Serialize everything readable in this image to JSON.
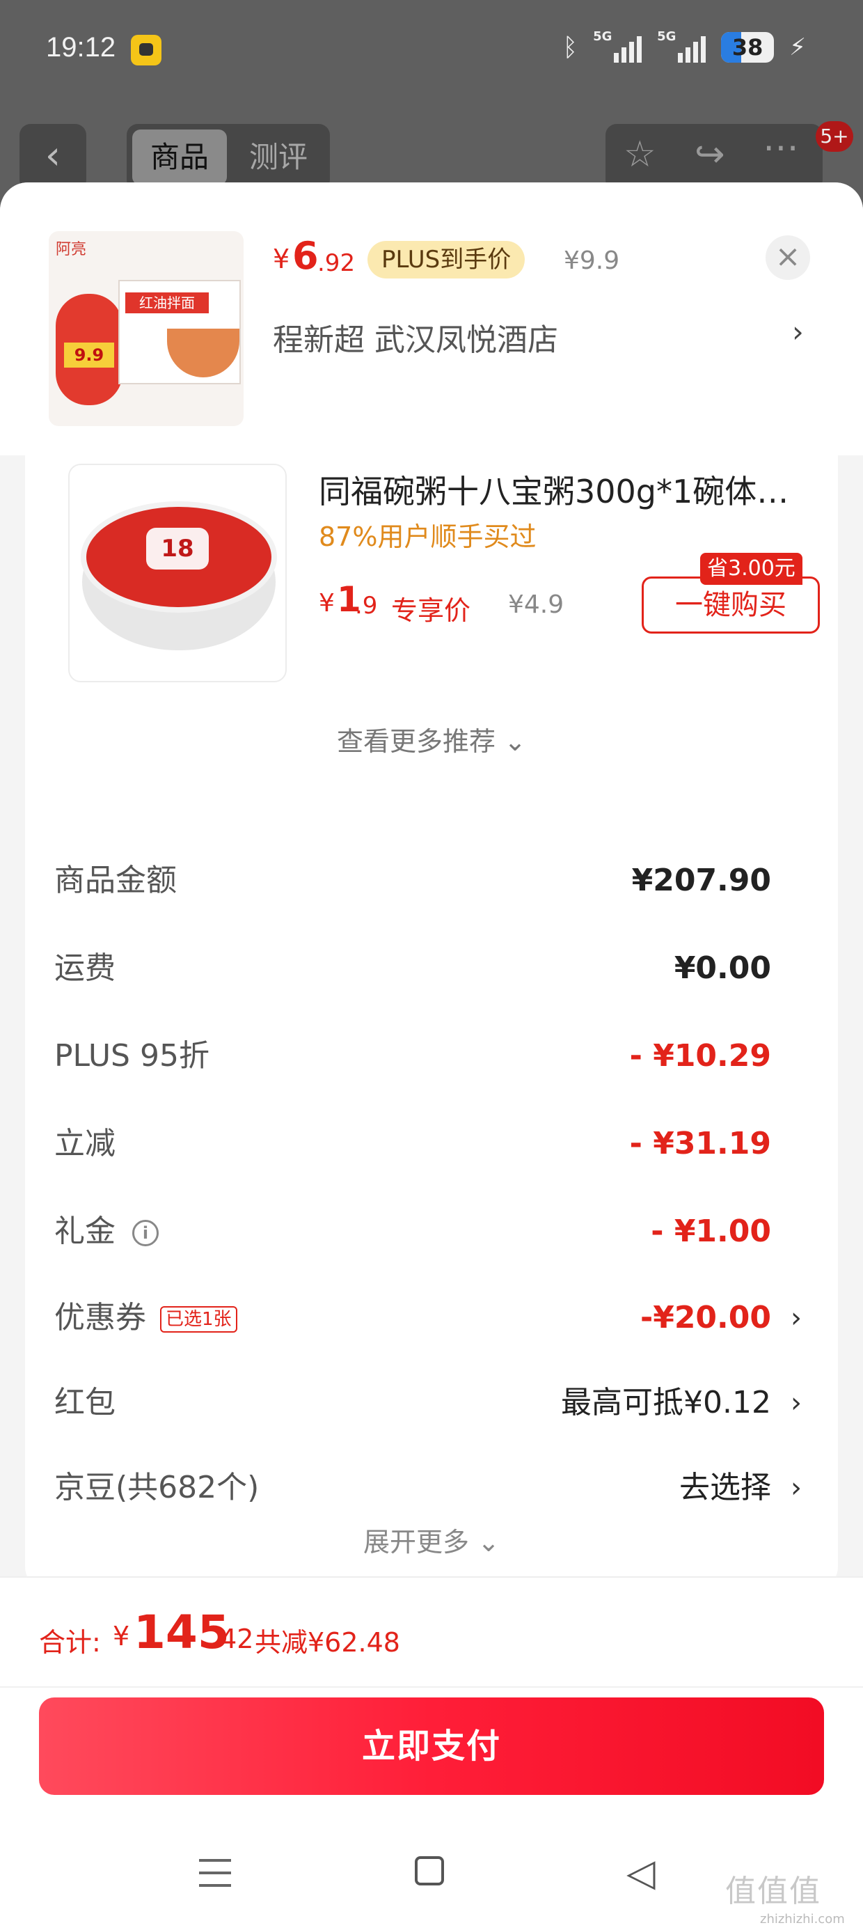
{
  "status_bar": {
    "time": "19:12",
    "network_1": "5G",
    "network_2": "5G",
    "battery": "38",
    "icons": [
      "app-notification-icon",
      "bluetooth-icon",
      "signal-icon",
      "signal-icon",
      "battery-icon",
      "charging-icon"
    ]
  },
  "page_header": {
    "back_icon": "chevron-left-icon",
    "tabs": [
      "商品",
      "测评"
    ],
    "actions": [
      "star-icon",
      "share-icon",
      "more-icon"
    ],
    "badge": "5+"
  },
  "product_sheet": {
    "image_brand": "阿亮",
    "image_pack_title": "红油拌面",
    "image_tag": "9.9",
    "price_yen": "¥",
    "price_int": "6",
    "price_dec": ".92",
    "plus_label": "PLUS到手价",
    "original_price": "¥9.9",
    "address": "程新超  武汉凤悦酒店",
    "close_icon": "close-icon"
  },
  "recommendation": {
    "title": "同福碗粥十八宝粥300g*1碗体…",
    "buyers_text": "87%用户顺手买过",
    "image_label": "18",
    "price_yen": "¥",
    "price_int": "1",
    "price_dec": ".9",
    "exclusive_label": "专享价",
    "original_price": "¥4.9",
    "save_badge": "省3.00元",
    "buy_button": "一键购买",
    "more_link": "查看更多推荐 ⌄"
  },
  "summary": {
    "rows": [
      {
        "label": "商品金额",
        "value": "¥207.90"
      },
      {
        "label": "运费",
        "value": "¥0.00"
      },
      {
        "label": "PLUS 95折",
        "value": "- ¥10.29"
      },
      {
        "label": "立减",
        "value": "- ¥31.19"
      },
      {
        "label": "礼金",
        "value": "- ¥1.00",
        "info_icon": "i"
      },
      {
        "label": "优惠券",
        "value": "-¥20.00",
        "tag": "已选1张"
      },
      {
        "label": "红包",
        "value": "最高可抵¥0.12"
      },
      {
        "label": "京豆(共682个)",
        "value": "去选择"
      }
    ],
    "expand_text": "展开更多 ⌄"
  },
  "checkout": {
    "total_label": "合计:",
    "total_yen": "¥",
    "total_int": "145",
    "total_dec": ".42",
    "total_saved": "共减¥62.48",
    "pay_button": "立即支付"
  },
  "watermark": {
    "main": "值值值",
    "sub": "zhizhizhi.com"
  },
  "colors": {
    "accent_red": "#e2231a",
    "plus_gold": "#fbe9b0",
    "buyers_orange": "#e08a1c"
  }
}
